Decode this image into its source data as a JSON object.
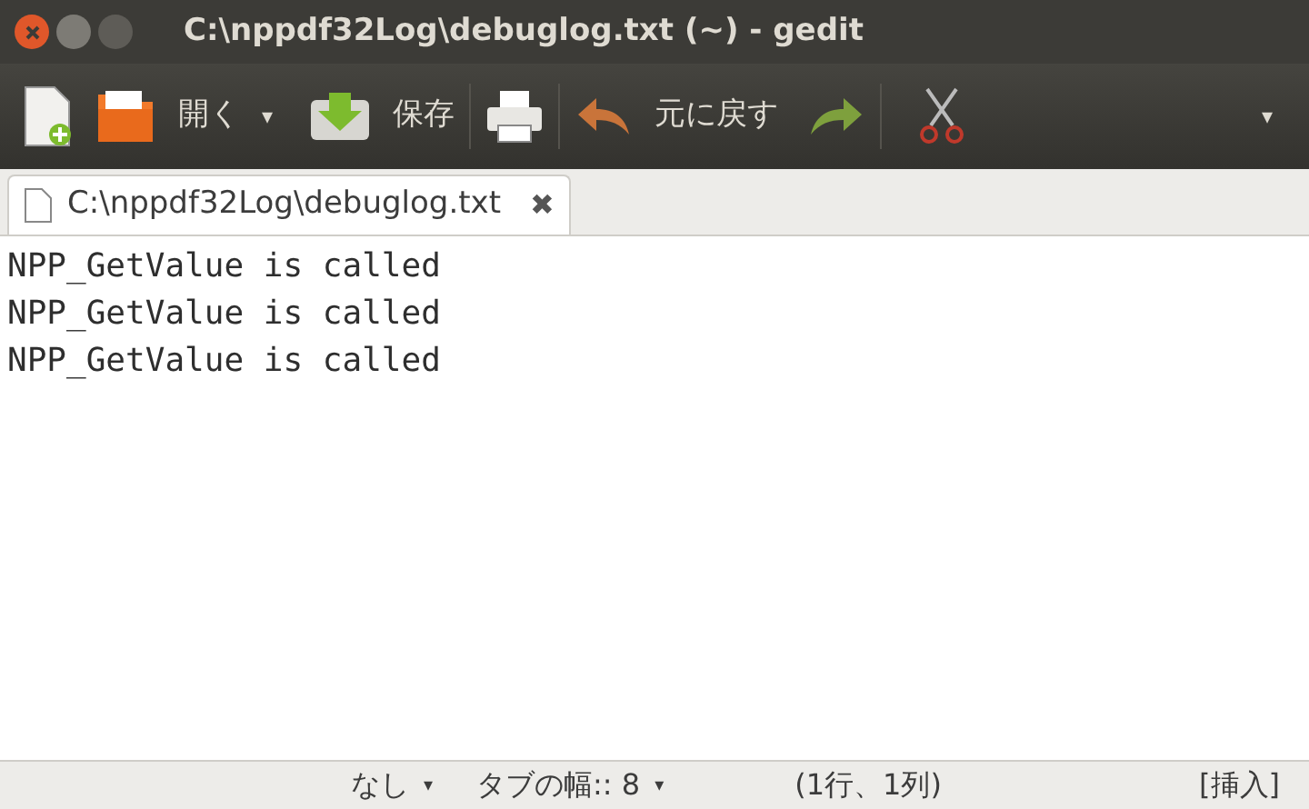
{
  "window": {
    "title": "C:\\nppdf32Log\\debuglog.txt (~) - gedit"
  },
  "toolbar": {
    "open_label": "開く",
    "open_arrow": "▾",
    "save_label": "保存",
    "undo_label": "元に戻す",
    "overflow_arrow": "▾"
  },
  "tabs": [
    {
      "label": "C:\\nppdf32Log\\debuglog.txt",
      "close": "✖",
      "selected": true
    }
  ],
  "editor": {
    "lines": [
      "NPP_GetValue is called",
      "NPP_GetValue is called",
      "NPP_GetValue is called"
    ]
  },
  "status_bar": {
    "highlight": "なし",
    "highlight_arrow": "▾",
    "tab_width": "タブの幅:: 8",
    "tab_width_arrow": "▾",
    "position": "(1行、1列)",
    "mode": "[挿入]"
  }
}
